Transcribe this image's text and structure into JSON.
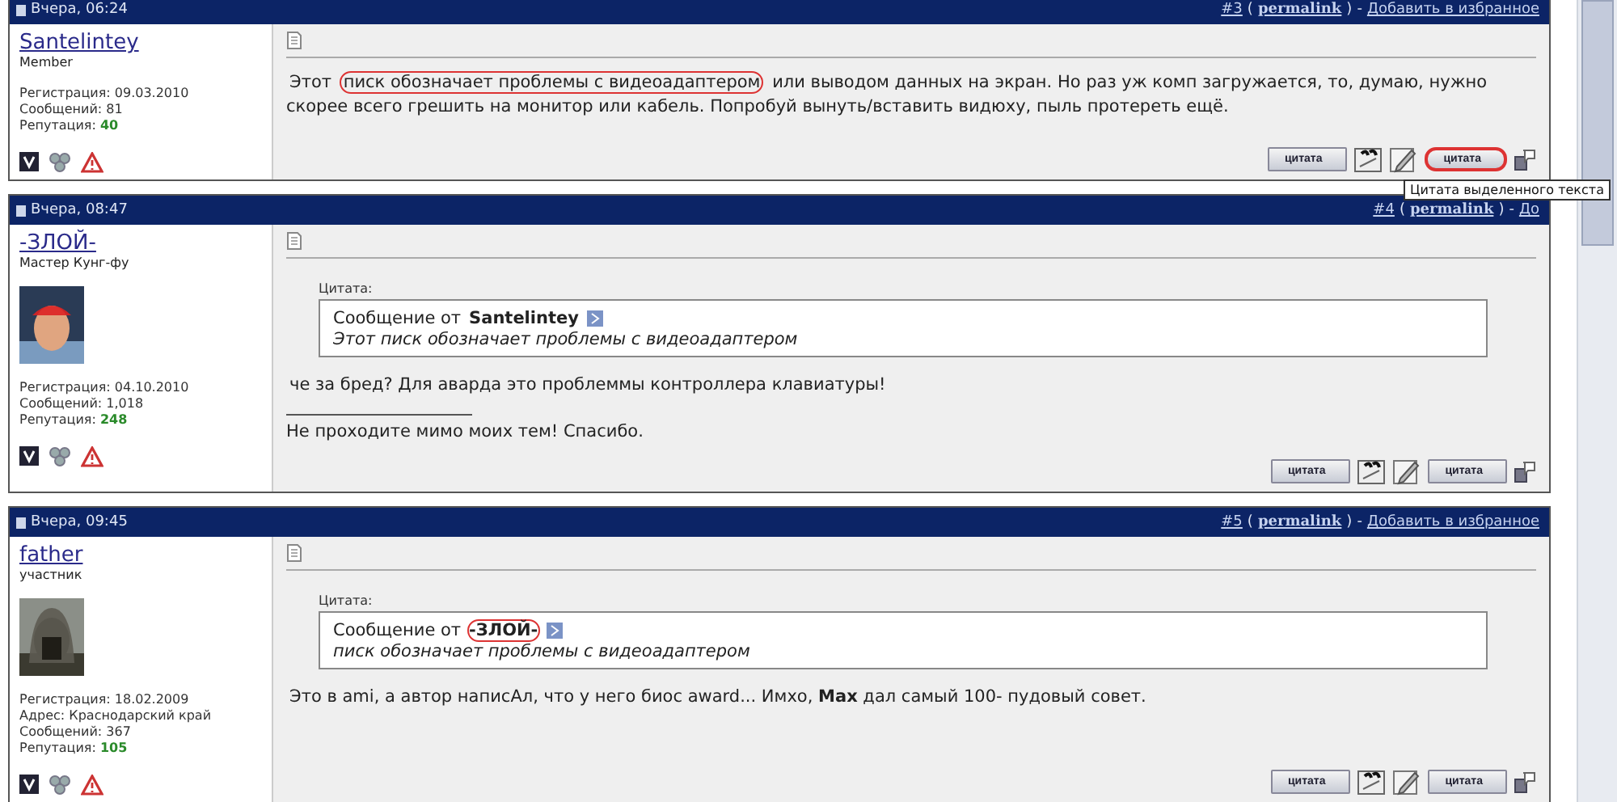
{
  "posts": [
    {
      "date": "Вчера, 06:24",
      "number": "#3",
      "paren_open": "(",
      "permalink": "permalink",
      "paren_close": ")",
      "separator": "-",
      "favorite": "Добавить в избранное",
      "user": {
        "name": "Santelintey",
        "title": "Member",
        "stats": [
          {
            "label": "Регистрация:",
            "value": "09.03.2010",
            "kind": "plain"
          },
          {
            "label": "Сообщений:",
            "value": "81",
            "kind": "plain"
          },
          {
            "label": "Репутация:",
            "value": "40",
            "kind": "reputation"
          }
        ]
      },
      "body": [
        {
          "text": "Этот ",
          "circled": false
        },
        {
          "text": "писк обозначает проблемы с видеоадаптером",
          "circled": true
        },
        {
          "text": " или выводом данных на экран. Но раз уж комп загружается, то, думаю, нужно скорее всего грешить на монитор или кабель. Попробуй вынуть/вставить видюху, пыль протереть ещё.",
          "circled": false
        }
      ],
      "buttons": [
        {
          "kind": "text",
          "label": "цитата",
          "circled": false
        },
        {
          "kind": "multiquote"
        },
        {
          "kind": "edit"
        },
        {
          "kind": "text",
          "label": "цитата",
          "circled": true
        },
        {
          "kind": "reply"
        }
      ]
    },
    {
      "date": "Вчера, 08:47",
      "number": "#4",
      "paren_open": "(",
      "permalink": "permalink",
      "paren_close": ")",
      "separator": "-",
      "favorite": "До",
      "user": {
        "name": "-ЗЛОЙ-",
        "title": "Мастер Кунг-фу",
        "stats": [
          {
            "label": "Регистрация:",
            "value": "04.10.2010",
            "kind": "plain"
          },
          {
            "label": "Сообщений:",
            "value": "1,018",
            "kind": "plain"
          },
          {
            "label": "Репутация:",
            "value": "248",
            "kind": "reputation"
          }
        ]
      },
      "quote": {
        "label": "Цитата:",
        "prefix": "Сообщение от",
        "author": "Santelintey",
        "author_circled": false,
        "text": "Этот писк обозначает проблемы с видеоадаптером"
      },
      "body": [
        {
          "text": "че за бред? Для аварда это проблеммы контроллера клавиатуры!",
          "circled": false
        }
      ],
      "signature": "Не проходите мимо моих тем! Спасибо.",
      "buttons": [
        {
          "kind": "text",
          "label": "цитата",
          "circled": false
        },
        {
          "kind": "multiquote"
        },
        {
          "kind": "edit"
        },
        {
          "kind": "text",
          "label": "цитата",
          "circled": false
        },
        {
          "kind": "reply"
        }
      ]
    },
    {
      "date": "Вчера, 09:45",
      "number": "#5",
      "paren_open": "(",
      "permalink": "permalink",
      "paren_close": ")",
      "separator": "-",
      "favorite": "Добавить в избранное",
      "user": {
        "name": "father",
        "title": "участник",
        "stats": [
          {
            "label": "Регистрация:",
            "value": "18.02.2009",
            "kind": "plain"
          },
          {
            "label": "Адрес:",
            "value": "Краснодарский край",
            "kind": "plain"
          },
          {
            "label": "Сообщений:",
            "value": "367",
            "kind": "plain"
          },
          {
            "label": "Репутация:",
            "value": "105",
            "kind": "reputation"
          }
        ]
      },
      "quote": {
        "label": "Цитата:",
        "prefix": "Сообщение от",
        "author": "-ЗЛОЙ-",
        "author_circled": true,
        "text": "писк обозначает проблемы с видеоадаптером"
      },
      "body": [
        {
          "text": "Это в ami, а автор написАл, что у него биос award... Имхо, **Max** дал самый 100- пудовый совет.",
          "circled": false
        }
      ],
      "buttons": [
        {
          "kind": "text",
          "label": "цитата",
          "circled": false
        },
        {
          "kind": "multiquote"
        },
        {
          "kind": "edit"
        },
        {
          "kind": "text",
          "label": "цитата",
          "circled": false
        },
        {
          "kind": "reply"
        }
      ]
    }
  ],
  "tooltip": "Цитата выделенного текста"
}
